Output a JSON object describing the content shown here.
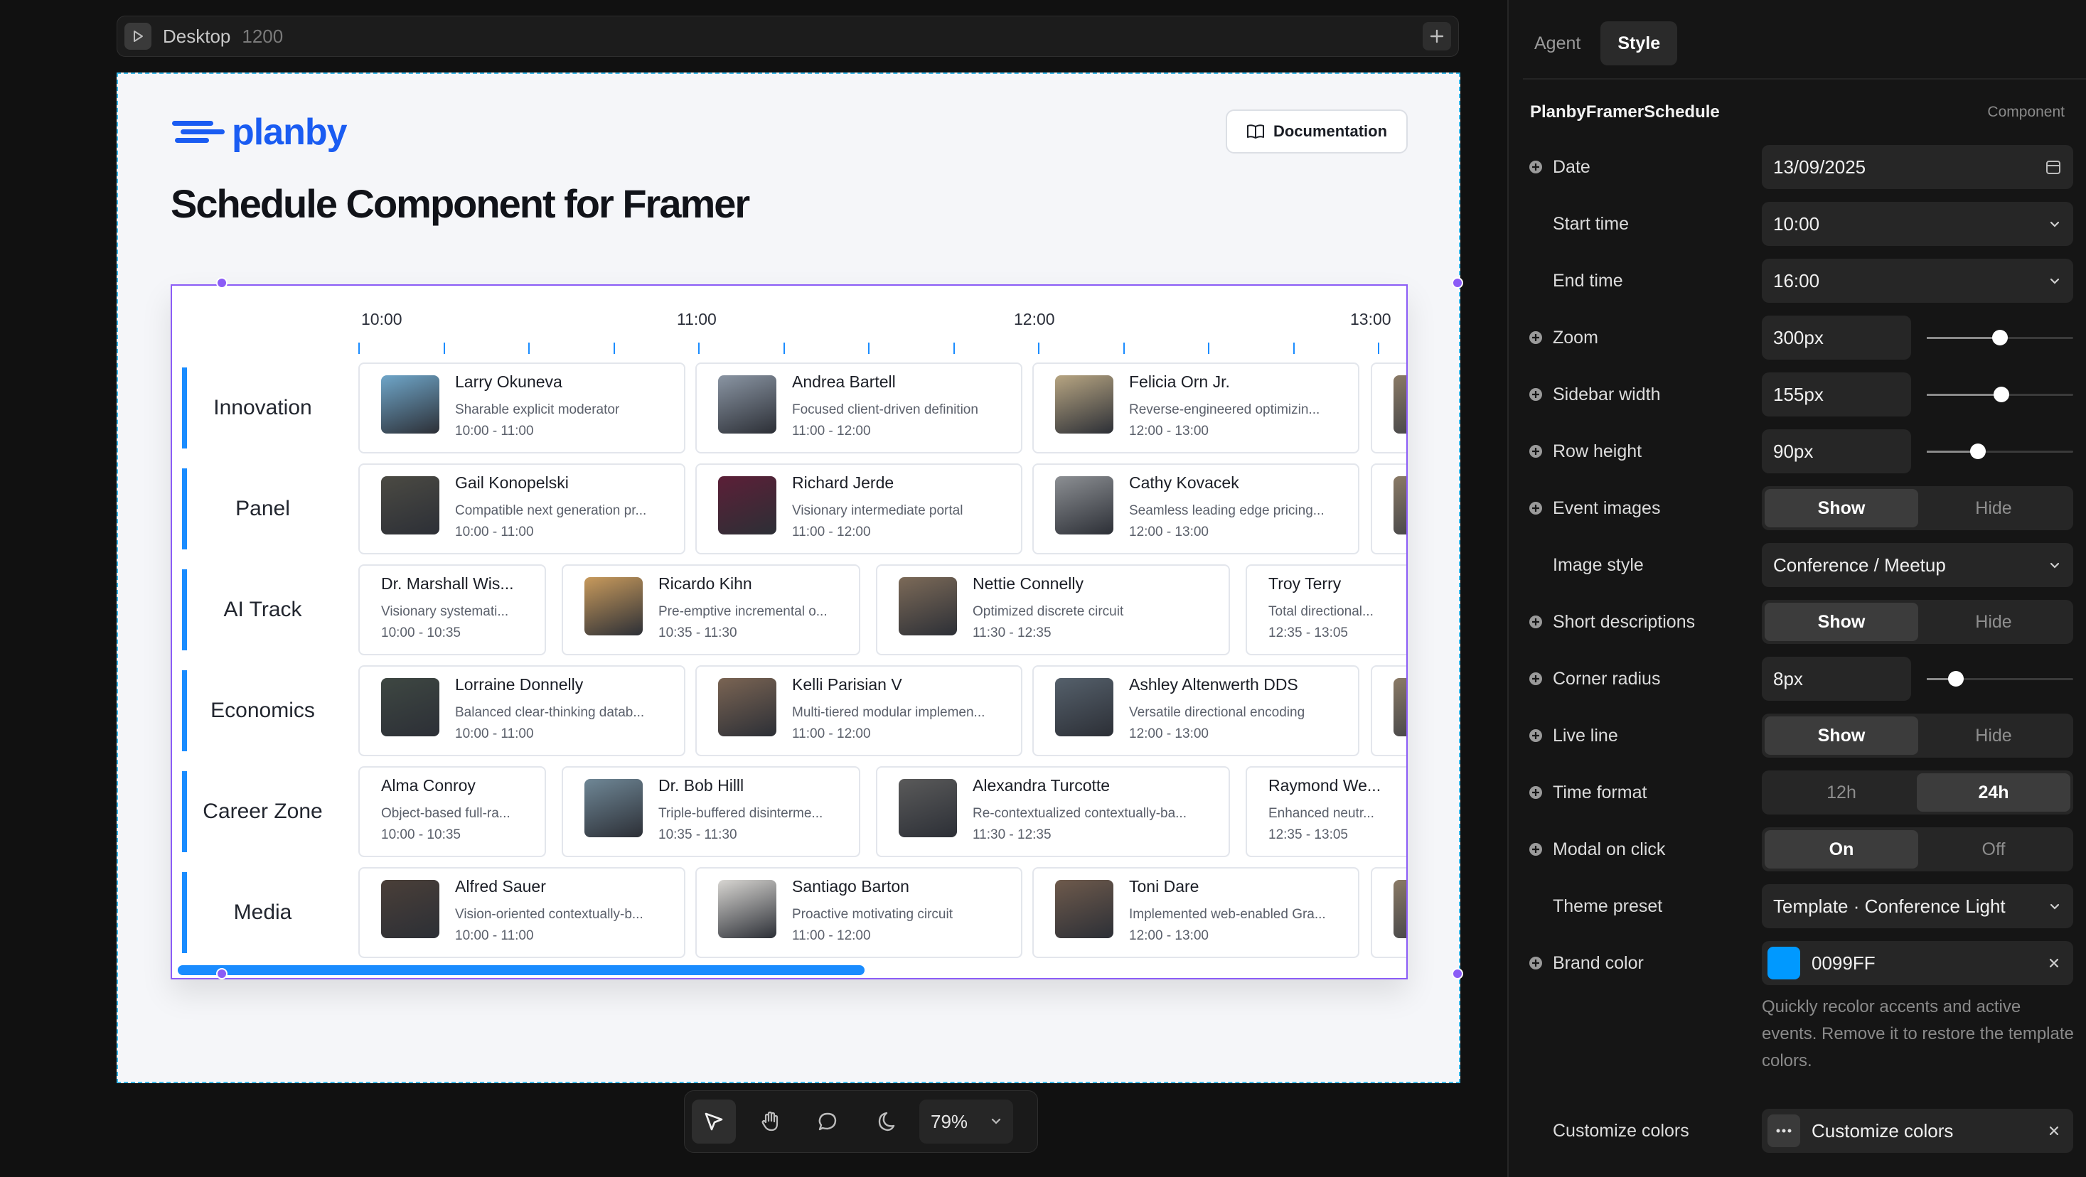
{
  "canvas": {
    "name": "Desktop",
    "width_label": "1200",
    "brand": "planby",
    "doc_button": "Documentation",
    "title": "Schedule Component for Framer"
  },
  "schedule": {
    "times": [
      "10:00",
      "11:00",
      "12:00",
      "13:00"
    ],
    "rows": [
      {
        "label": "Innovation",
        "events": [
          {
            "title": "Larry Okuneva",
            "desc": "Sharable explicit moderator",
            "time": "10:00 - 11:00",
            "img": "#6fa6c9"
          },
          {
            "title": "Andrea Bartell",
            "desc": "Focused client-driven definition",
            "time": "11:00 - 12:00",
            "img": "#8a95a3"
          },
          {
            "title": "Felicia Orn Jr.",
            "desc": "Reverse-engineered optimizin...",
            "time": "12:00 - 13:00",
            "img": "#b7a582"
          }
        ]
      },
      {
        "label": "Panel",
        "events": [
          {
            "title": "Gail Konopelski",
            "desc": "Compatible next generation pr...",
            "time": "10:00 - 11:00",
            "img": "#4b4a43"
          },
          {
            "title": "Richard Jerde",
            "desc": "Visionary intermediate portal",
            "time": "11:00 - 12:00",
            "img": "#5c1f37"
          },
          {
            "title": "Cathy Kovacek",
            "desc": "Seamless leading edge pricing...",
            "time": "12:00 - 13:00",
            "img": "#8c8f93"
          }
        ]
      },
      {
        "label": "AI Track",
        "events": [
          {
            "title": "Dr. Marshall Wis...",
            "desc": "Visionary systemati...",
            "time": "10:00 - 10:35",
            "img": ""
          },
          {
            "title": "Ricardo Kihn",
            "desc": "Pre-emptive incremental o...",
            "time": "10:35 - 11:30",
            "img": "#c89a5c"
          },
          {
            "title": "Nettie Connelly",
            "desc": "Optimized discrete circuit",
            "time": "11:30 - 12:35",
            "img": "#7c6a58"
          },
          {
            "title": "Troy Terry",
            "desc": "Total directional...",
            "time": "12:35 - 13:05",
            "img": ""
          }
        ]
      },
      {
        "label": "Economics",
        "events": [
          {
            "title": "Lorraine Donnelly",
            "desc": "Balanced clear-thinking datab...",
            "time": "10:00 - 11:00",
            "img": "#3e4742"
          },
          {
            "title": "Kelli Parisian V",
            "desc": "Multi-tiered modular implemen...",
            "time": "11:00 - 12:00",
            "img": "#7a6453"
          },
          {
            "title": "Ashley Altenwerth DDS",
            "desc": "Versatile directional encoding",
            "time": "12:00 - 13:00",
            "img": "#55606b"
          }
        ]
      },
      {
        "label": "Career Zone",
        "events": [
          {
            "title": "Alma Conroy",
            "desc": "Object-based full-ra...",
            "time": "10:00 - 10:35",
            "img": ""
          },
          {
            "title": "Dr. Bob Hilll",
            "desc": "Triple-buffered disinterme...",
            "time": "10:35 - 11:30",
            "img": "#6f8796"
          },
          {
            "title": "Alexandra Turcotte",
            "desc": "Re-contextualized contextually-ba...",
            "time": "11:30 - 12:35",
            "img": "#5a5a5a"
          },
          {
            "title": "Raymond We...",
            "desc": "Enhanced neutr...",
            "time": "12:35 - 13:05",
            "img": ""
          }
        ]
      },
      {
        "label": "Media",
        "events": [
          {
            "title": "Alfred Sauer",
            "desc": "Vision-oriented contextually-b...",
            "time": "10:00 - 11:00",
            "img": "#4a3f38"
          },
          {
            "title": "Santiago Barton",
            "desc": "Proactive motivating circuit",
            "time": "11:00 - 12:00",
            "img": "#d8d6d2"
          },
          {
            "title": "Toni Dare",
            "desc": "Implemented web-enabled Gra...",
            "time": "12:00 - 13:00",
            "img": "#6e5a4c"
          }
        ]
      }
    ]
  },
  "toolbar": {
    "zoom": "79%"
  },
  "panel": {
    "tabs": [
      "Agent",
      "Style"
    ],
    "active_tab": "Style",
    "component": "PlanbyFramerSchedule",
    "component_tag": "Component",
    "date_label": "Date",
    "date_value": "13/09/2025",
    "start_label": "Start time",
    "start_value": "10:00",
    "end_label": "End time",
    "end_value": "16:00",
    "zoom_label": "Zoom",
    "zoom_value": "300px",
    "zoom_level": 0.5,
    "sidebar_label": "Sidebar width",
    "sidebar_value": "155px",
    "sidebar_level": 0.51,
    "rowh_label": "Row height",
    "rowh_value": "90px",
    "rowh_level": 0.35,
    "images_label": "Event images",
    "images_on": "Show",
    "images_off": "Hide",
    "imgstyle_label": "Image style",
    "imgstyle_value": "Conference / Meetup",
    "short_label": "Short descriptions",
    "short_on": "Show",
    "short_off": "Hide",
    "radius_label": "Corner radius",
    "radius_value": "8px",
    "radius_level": 0.2,
    "live_label": "Live line",
    "live_on": "Show",
    "live_off": "Hide",
    "timefmt_label": "Time format",
    "timefmt_12": "12h",
    "timefmt_24": "24h",
    "modal_label": "Modal on click",
    "modal_on": "On",
    "modal_off": "Off",
    "theme_label": "Theme preset",
    "theme_value": "Template · Conference Light",
    "brand_label": "Brand color",
    "brand_value": "0099FF",
    "brand_color": "#0099FF",
    "help": "Quickly recolor accents and active events. Remove it to restore the template colors.",
    "customize_label": "Customize colors",
    "customize_value": "Customize colors"
  },
  "colors": {
    "accent": "#1a8cff",
    "selection": "#8b5cf6",
    "brand": "#1a5cf2"
  }
}
